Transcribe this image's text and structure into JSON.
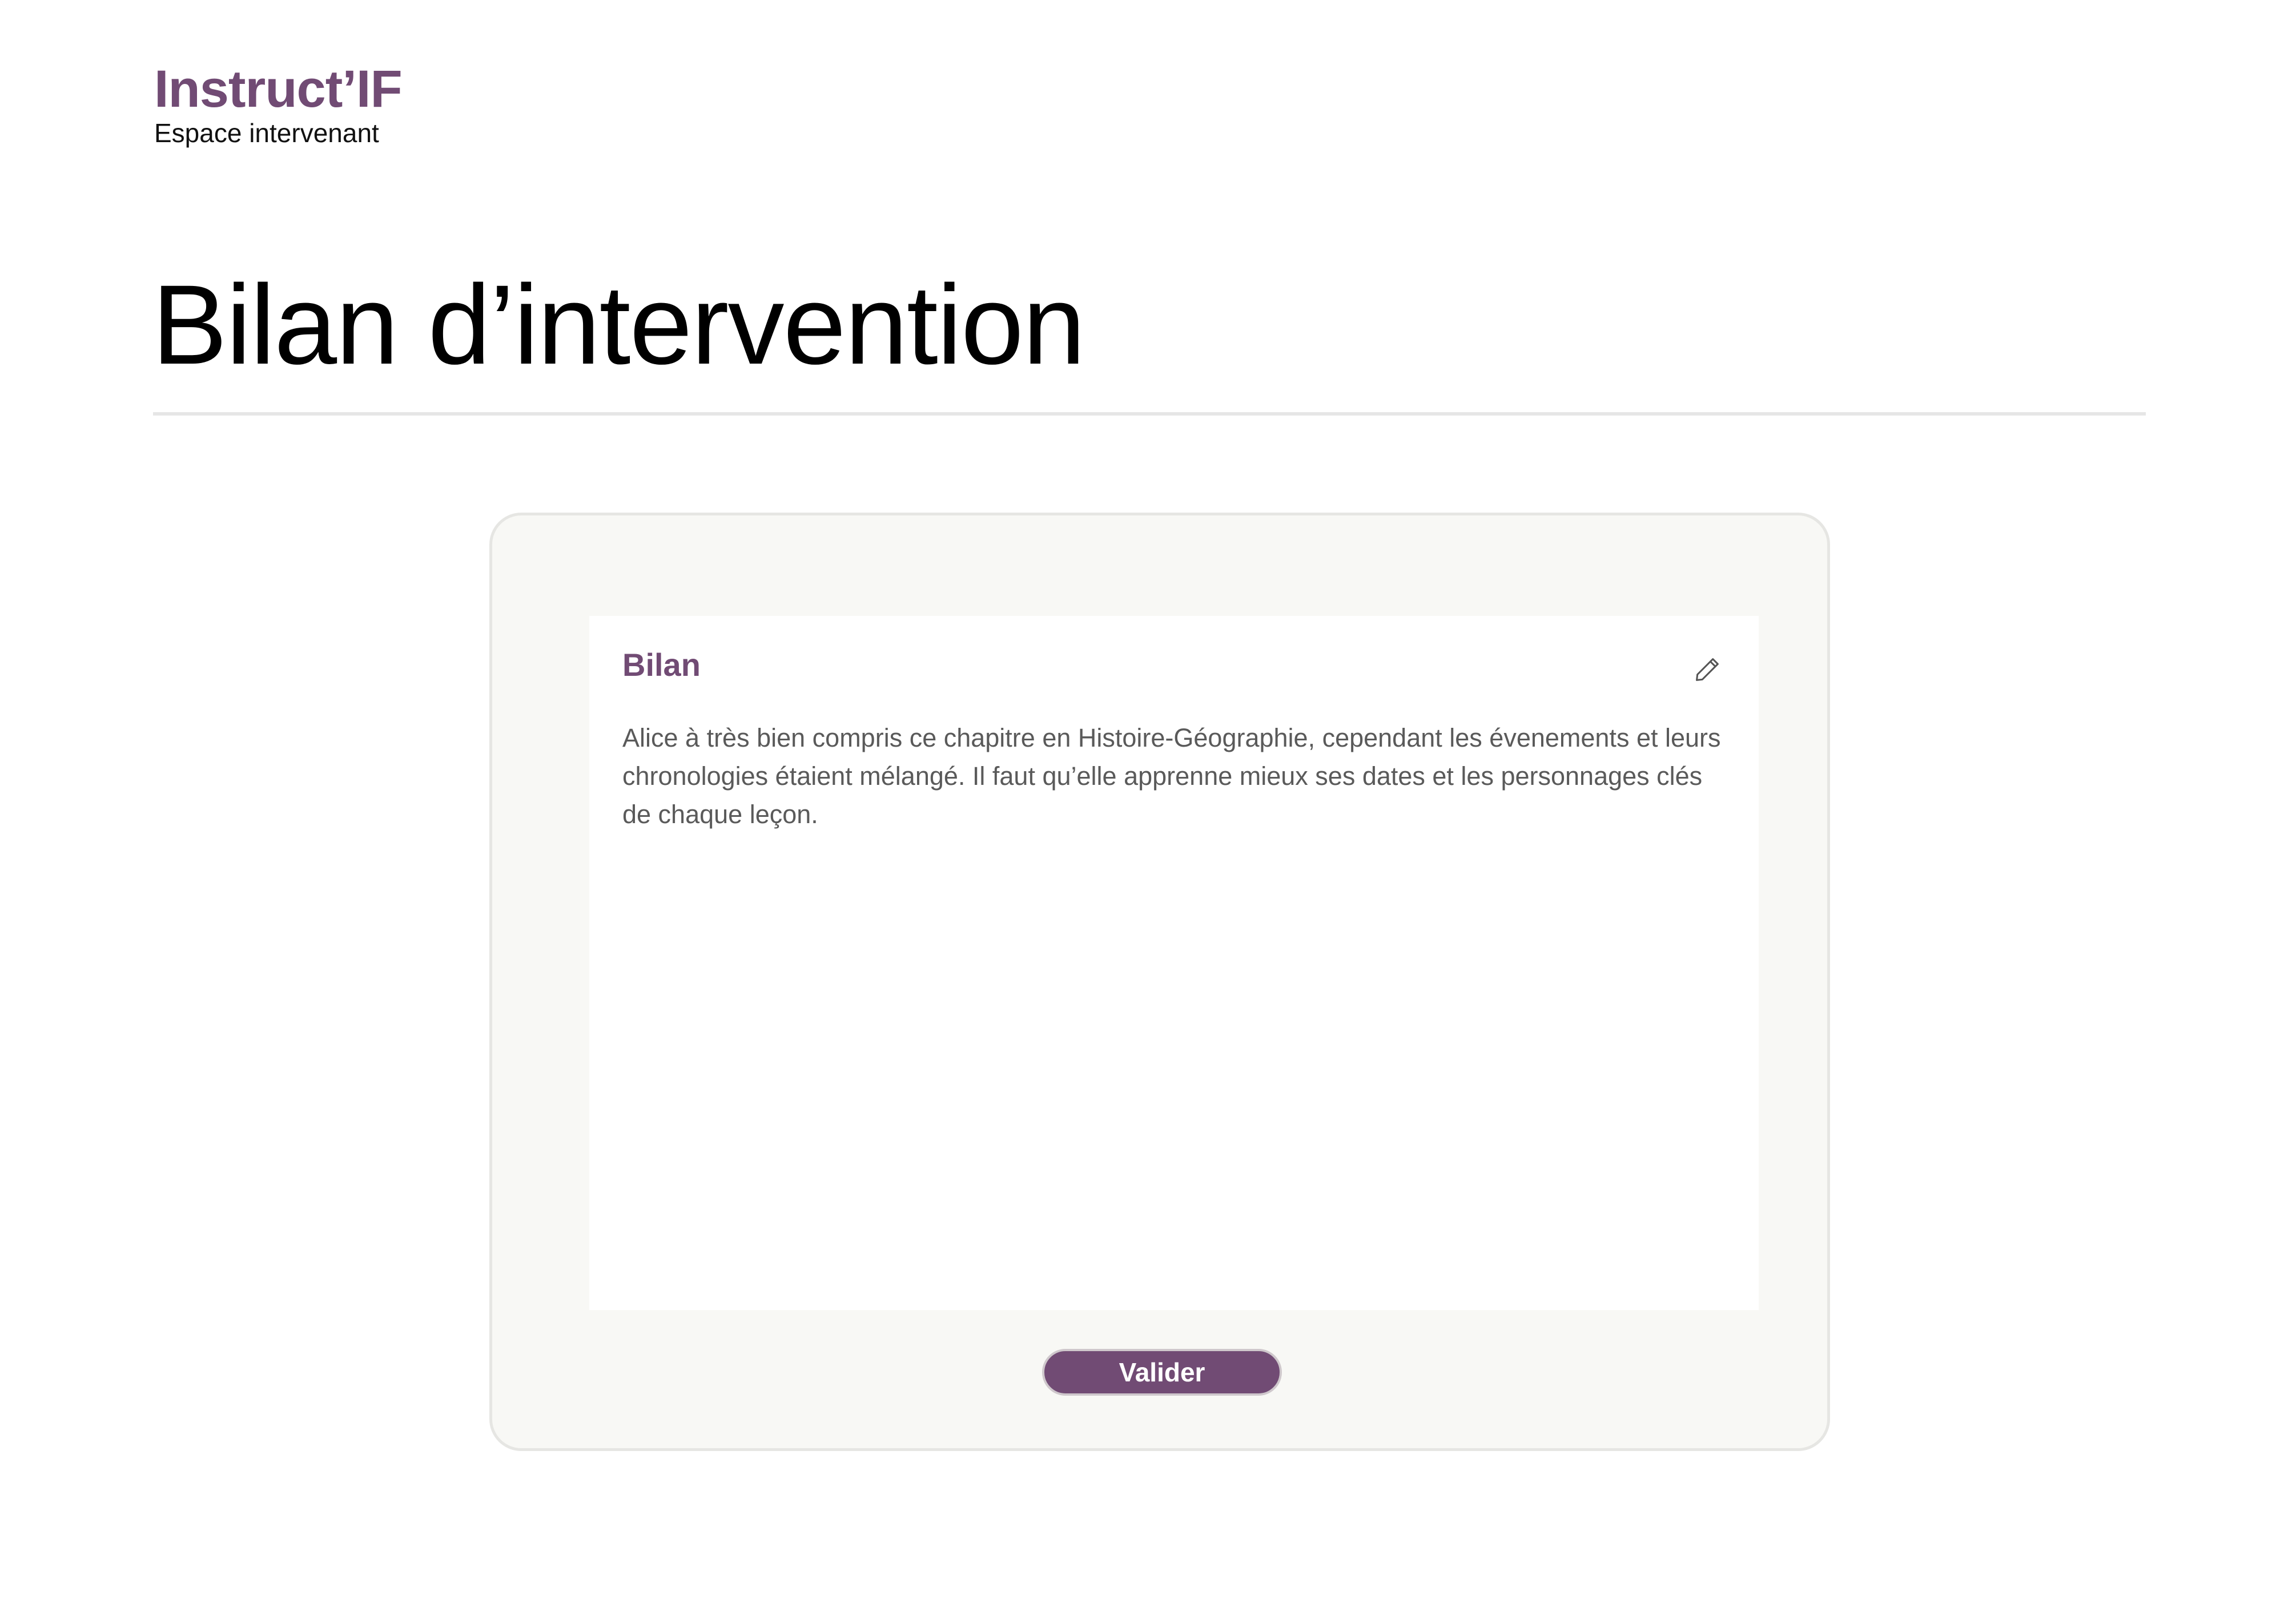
{
  "header": {
    "brand_name": "Instruct’IF",
    "brand_subtitle": "Espace intervenant"
  },
  "page": {
    "title": "Bilan d’intervention"
  },
  "bilan": {
    "title": "Bilan",
    "text": "Alice à très bien compris ce chapitre en Histoire-Géographie, cependant les évenements et leurs chronologies étaient mélangé. Il faut qu’elle apprenne mieux ses dates et les personnages clés de chaque leçon.",
    "edit_icon": "pencil-icon"
  },
  "actions": {
    "validate_label": "Valider"
  },
  "colors": {
    "brand": "#714b74",
    "card_background": "#f8f8f5",
    "divider": "#e6e6e6"
  }
}
